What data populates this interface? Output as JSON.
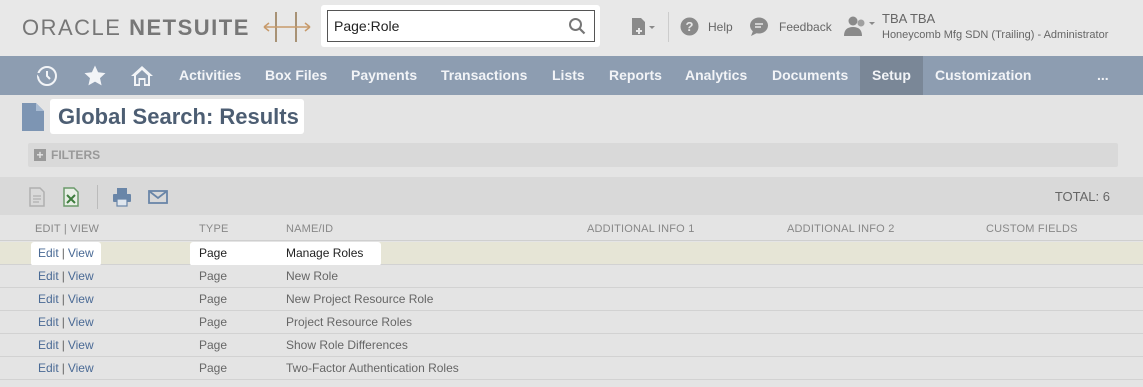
{
  "brand": {
    "part1": "ORACLE",
    "part2": "NETSUITE"
  },
  "search": {
    "value": "Page:Role"
  },
  "header": {
    "help_label": "Help",
    "feedback_label": "Feedback",
    "user_name": "TBA TBA",
    "user_role": "Honeycomb Mfg SDN (Trailing) - Administrator"
  },
  "nav": {
    "items": [
      "Activities",
      "Box Files",
      "Payments",
      "Transactions",
      "Lists",
      "Reports",
      "Analytics",
      "Documents",
      "Setup",
      "Customization"
    ],
    "active": "Setup",
    "more": "..."
  },
  "page": {
    "title": "Global Search: Results",
    "filters_label": "FILTERS",
    "total": "TOTAL: 6"
  },
  "table": {
    "headers": [
      "EDIT | VIEW",
      "TYPE",
      "NAME/ID",
      "ADDITIONAL INFO 1",
      "ADDITIONAL INFO 2",
      "CUSTOM FIELDS"
    ],
    "edit_label": "Edit",
    "view_label": "View",
    "rows": [
      {
        "type": "Page",
        "name": "Manage Roles"
      },
      {
        "type": "Page",
        "name": "New Role"
      },
      {
        "type": "Page",
        "name": "New Project Resource Role"
      },
      {
        "type": "Page",
        "name": "Project Resource Roles"
      },
      {
        "type": "Page",
        "name": "Show Role Differences"
      },
      {
        "type": "Page",
        "name": "Two-Factor Authentication Roles"
      }
    ]
  },
  "colors": {
    "nav_bg": "#8d9db1",
    "nav_active": "#7a8797",
    "link": "#4a6a95",
    "title": "#4d5e73"
  }
}
